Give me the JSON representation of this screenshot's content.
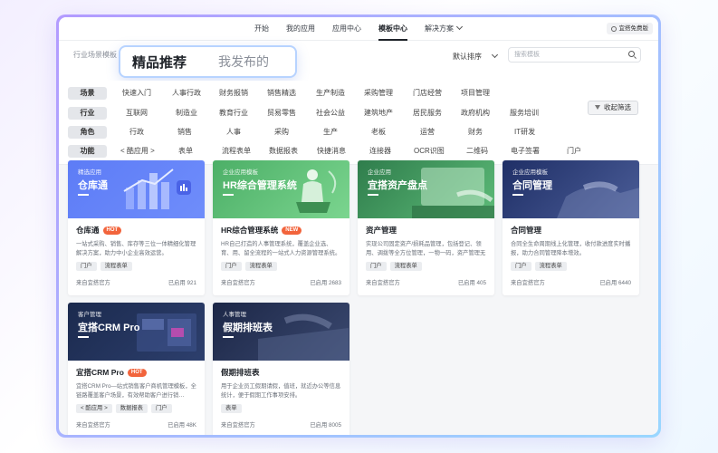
{
  "topnav": {
    "links": [
      "开始",
      "我的应用",
      "应用中心",
      "模板中心",
      "解决方案"
    ],
    "active_index": 3,
    "free_label": "宜搭免费版"
  },
  "header": {
    "crumb": "行业场景模板",
    "tab_featured": "精品推荐",
    "tab_mine": "我发布的",
    "sort_label": "默认排序",
    "search_placeholder": "搜索模板"
  },
  "filters": {
    "collapse_label": "收起筛选",
    "rows": [
      {
        "key": "场景",
        "options": [
          "快速入门",
          "人事行政",
          "财务报销",
          "销售精选",
          "生产制造",
          "采购管理",
          "门店经营",
          "项目管理"
        ]
      },
      {
        "key": "行业",
        "options": [
          "互联网",
          "制造业",
          "教育行业",
          "贸易零售",
          "社会公益",
          "建筑地产",
          "居民服务",
          "政府机构",
          "服务培训"
        ]
      },
      {
        "key": "角色",
        "options": [
          "行政",
          "销售",
          "人事",
          "采购",
          "生产",
          "老板",
          "运营",
          "财务",
          "IT研发"
        ]
      },
      {
        "key": "功能",
        "options": [
          "< 酷应用 >",
          "表单",
          "流程表单",
          "数据报表",
          "快捷消息",
          "连接器",
          "OCR识图",
          "二维码",
          "电子签署",
          "门户"
        ]
      }
    ]
  },
  "cards": [
    {
      "banner_small": "精选应用",
      "banner_big": "仓库通",
      "title": "仓库通",
      "badge": "HOT",
      "desc": "一站式采购、销售、库存等三位一体精细化管理解决方案，助力中小企业高效运营。",
      "tags": [
        "门户",
        "流程表单"
      ],
      "source": "来自宜搭官方",
      "usage": "已启用 921"
    },
    {
      "banner_small": "企业应用模板",
      "banner_big": "HR综合管理系统",
      "title": "HR综合管理系统",
      "badge": "NEW",
      "desc": "HR自己打造的人事管理系统，覆盖企业选、育、用、留全流程的一站式人力资源管理系统。",
      "tags": [
        "门户",
        "流程表单"
      ],
      "source": "来自宜搭官方",
      "usage": "已启用 2683"
    },
    {
      "banner_small": "企业应用",
      "banner_big": "宜搭资产盘点",
      "title": "资产管理",
      "badge": "",
      "desc": "实现公司固定资产/损耗品管理，包括登记、领用、调拨等全方位管理，一物一码，资产管理无纸化。",
      "tags": [
        "门户",
        "流程表单"
      ],
      "source": "来自宜搭官方",
      "usage": "已启用 405"
    },
    {
      "banner_small": "企业应用模板",
      "banner_big": "合同管理",
      "title": "合同管理",
      "badge": "",
      "desc": "合同全生命周期线上化管理，收付款进度实时播报，助力合同管理降本增效。",
      "tags": [
        "门户",
        "流程表单"
      ],
      "source": "来自宜搭官方",
      "usage": "已启用 6440"
    },
    {
      "banner_small": "客户管理",
      "banner_big": "宜搭CRM Pro",
      "title": "宜搭CRM Pro",
      "badge": "HOT",
      "desc": "宜搭CRM Pro—站式销售客户商机管理模板，全链路覆盖客户场景，有效帮助客户进行销…",
      "tags": [
        "< 酷应用 >",
        "数据报表",
        "门户"
      ],
      "source": "来自宜搭官方",
      "usage": "已启用 48K"
    },
    {
      "banner_small": "人事管理",
      "banner_big": "假期排班表",
      "title": "假期排班表",
      "badge": "",
      "desc": "用于企业员工假期请假，值班，就近办公等信息统计，便于假期工作事项安排。",
      "tags": [
        "表单"
      ],
      "source": "来自宜搭官方",
      "usage": "已启用 8005"
    }
  ]
}
